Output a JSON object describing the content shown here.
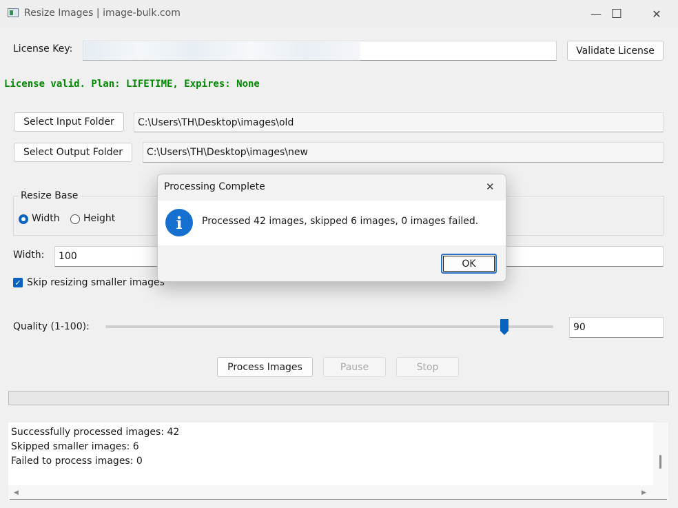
{
  "window": {
    "title": "Resize Images | image-bulk.com",
    "controls": {
      "minimize": "—",
      "maximize": "☐",
      "close": "✕"
    }
  },
  "license": {
    "label": "License Key:",
    "validate_button": "Validate License",
    "status": "License valid. Plan: LIFETIME, Expires: None"
  },
  "folders": {
    "input_button": "Select Input Folder",
    "input_path": "C:\\Users\\TH\\Desktop\\images\\old",
    "output_button": "Select Output Folder",
    "output_path": "C:\\Users\\TH\\Desktop\\images\\new"
  },
  "resize": {
    "group_label": "Resize Base",
    "options": [
      "Width",
      "Height"
    ],
    "selected": "Width",
    "size_label": "Width:",
    "size_value": "100",
    "skip_label": "Skip resizing smaller images",
    "skip_checked": true
  },
  "quality": {
    "label": "Quality (1-100):",
    "value": "90",
    "slider_fraction": 0.9
  },
  "actions": {
    "process": "Process Images",
    "pause": "Pause",
    "stop": "Stop"
  },
  "progress": {
    "fraction": 0.0
  },
  "log": [
    "Successfully processed images: 42",
    "Skipped smaller images: 6",
    "Failed to process images: 0"
  ],
  "dialog": {
    "title": "Processing Complete",
    "message": "Processed 42 images, skipped 6 images, 0 images failed.",
    "ok": "OK",
    "icon": "info-icon"
  },
  "colors": {
    "accent": "#0a62c0",
    "status_green": "#008800",
    "info_blue": "#1670d0"
  }
}
